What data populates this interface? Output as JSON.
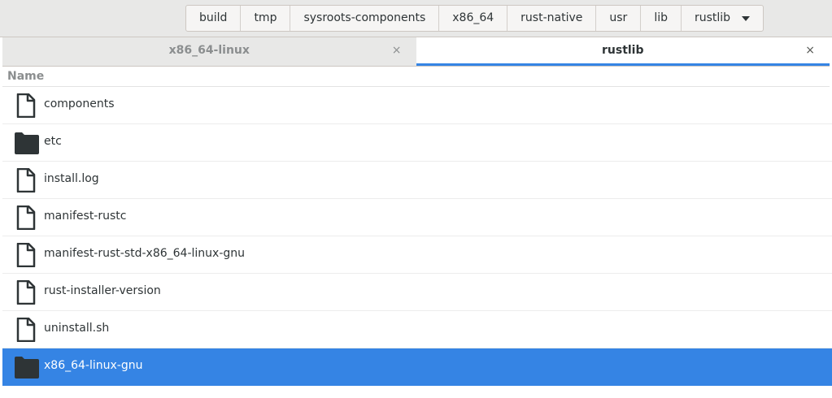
{
  "pathbar": {
    "crumbs": [
      "build",
      "tmp",
      "sysroots-components",
      "x86_64",
      "rust-native",
      "usr",
      "lib"
    ],
    "current": "rustlib"
  },
  "tabs": [
    {
      "label": "x86_64-linux",
      "close": "×"
    },
    {
      "label": "rustlib",
      "close": "×"
    }
  ],
  "list": {
    "column_header": "Name",
    "items": [
      {
        "name": "components",
        "type": "file"
      },
      {
        "name": "etc",
        "type": "folder"
      },
      {
        "name": "install.log",
        "type": "file"
      },
      {
        "name": "manifest-rustc",
        "type": "file"
      },
      {
        "name": "manifest-rust-std-x86_64-linux-gnu",
        "type": "file"
      },
      {
        "name": "rust-installer-version",
        "type": "file"
      },
      {
        "name": "uninstall.sh",
        "type": "file"
      },
      {
        "name": "x86_64-linux-gnu",
        "type": "folder",
        "selected": true
      }
    ]
  },
  "colors": {
    "accent": "#3584e4",
    "text": "#2e3436",
    "muted": "#8b8e8f"
  }
}
